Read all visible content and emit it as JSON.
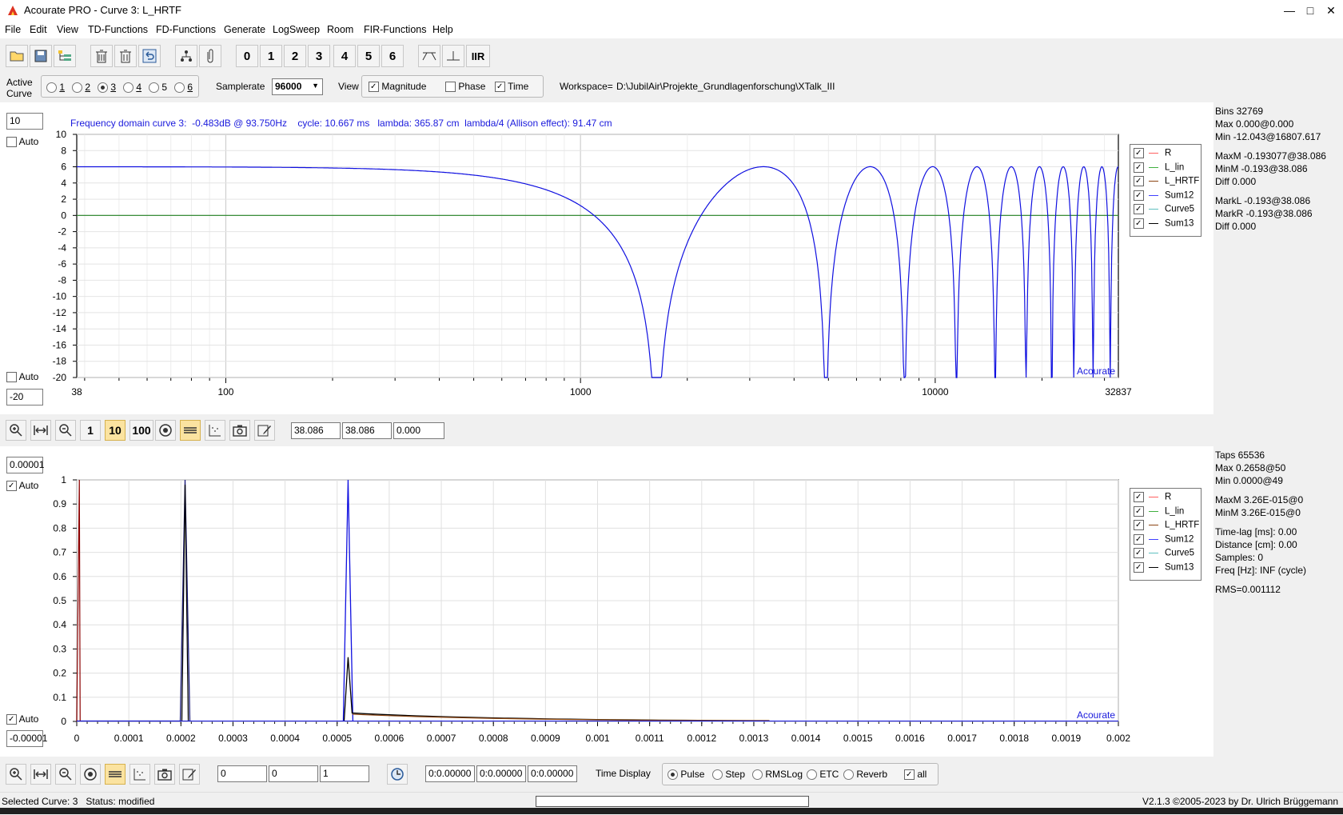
{
  "window": {
    "title": "Acourate PRO - Curve 3: L_HRTF"
  },
  "menu": [
    "File",
    "Edit",
    "View",
    "TD-Functions",
    "FD-Functions",
    "Generate",
    "LogSweep",
    "Room",
    "FIR-Functions",
    "Help"
  ],
  "toolbar": {
    "number_buttons": [
      "0",
      "1",
      "2",
      "3",
      "4",
      "5",
      "6"
    ],
    "iir_label": "IIR"
  },
  "options": {
    "active_curve_label": "Active Curve",
    "curves": [
      "1",
      "2",
      "3",
      "4",
      "5",
      "6"
    ],
    "selected_curve": "3",
    "samplerate_label": "Samplerate",
    "samplerate_value": "96000",
    "view_label": "View",
    "view_options": [
      {
        "label": "Magnitude",
        "checked": true
      },
      {
        "label": "Phase",
        "checked": false
      },
      {
        "label": "Time",
        "checked": true
      }
    ],
    "workspace_label": "Workspace=",
    "workspace_path": "D:\\JubilAir\\Projekte_Grundlagenforschung\\XTalk_III"
  },
  "freq_plot": {
    "top_input": "10",
    "bottom_input": "-20",
    "auto_label": "Auto",
    "auto_top_checked": false,
    "auto_bottom_checked": false,
    "info": "Frequency domain curve 3:  -0.483dB @ 93.750Hz    cycle: 10.667 ms   lambda: 365.87 cm  lambda/4 (Allison effect): 91.47 cm",
    "watermark": "Acourate",
    "y_ticks": [
      "10",
      "8",
      "6",
      "4",
      "2",
      "0",
      "-2",
      "-4",
      "-6",
      "-8",
      "-10",
      "-12",
      "-14",
      "-16",
      "-18",
      "-20"
    ],
    "x_ticks": [
      "38",
      "100",
      "1000",
      "10000",
      "32837"
    ],
    "legend": [
      {
        "label": "R",
        "color": "#ff6060"
      },
      {
        "label": "L_lin",
        "color": "#40b040"
      },
      {
        "label": "L_HRTF",
        "color": "#8b4513"
      },
      {
        "label": "Sum12",
        "color": "#4040ff"
      },
      {
        "label": "Curve5",
        "color": "#60c0c0"
      },
      {
        "label": "Sum13",
        "color": "#000000"
      }
    ],
    "side_info": [
      "Bins 32769",
      "Max 0.000@0.000",
      "Min -12.043@16807.617",
      "",
      "MaxM -0.193077@38.086",
      "MinM -0.193@38.086",
      "Diff 0.000",
      "",
      "MarkL -0.193@38.086",
      "MarkR -0.193@38.086",
      "Diff 0.000"
    ]
  },
  "freq_controls": {
    "buttons": [
      "1",
      "10",
      "100"
    ],
    "active_button": "10",
    "fields": [
      "38.086",
      "38.086",
      "0.000"
    ]
  },
  "time_plot": {
    "top_input": "0.00001",
    "bottom_input": "-0.00001",
    "auto_label": "Auto",
    "auto_top_checked": true,
    "auto_bottom_checked": true,
    "watermark": "Acourate",
    "y_ticks": [
      "1",
      "0.9",
      "0.8",
      "0.7",
      "0.6",
      "0.5",
      "0.4",
      "0.3",
      "0.2",
      "0.1",
      "0"
    ],
    "x_ticks": [
      "0",
      "0.0001",
      "0.0002",
      "0.0003",
      "0.0004",
      "0.0005",
      "0.0006",
      "0.0007",
      "0.0008",
      "0.0009",
      "0.001",
      "0.0011",
      "0.0012",
      "0.0013",
      "0.0014",
      "0.0015",
      "0.0016",
      "0.0017",
      "0.0018",
      "0.0019",
      "0.002"
    ],
    "legend": [
      {
        "label": "R",
        "color": "#ff6060"
      },
      {
        "label": "L_lin",
        "color": "#40b040"
      },
      {
        "label": "L_HRTF",
        "color": "#8b4513"
      },
      {
        "label": "Sum12",
        "color": "#4040ff"
      },
      {
        "label": "Curve5",
        "color": "#60c0c0"
      },
      {
        "label": "Sum13",
        "color": "#000000"
      }
    ],
    "side_info": [
      "Taps 65536",
      "Max 0.2658@50",
      "Min 0.0000@49",
      "",
      "MaxM 3.26E-015@0",
      "MinM 3.26E-015@0",
      "",
      "Time-lag [ms]: 0.00",
      "Distance [cm]: 0.00",
      "Samples:  0",
      "Freq [Hz]: INF (cycle)",
      "",
      "RMS=0.001112"
    ]
  },
  "time_controls": {
    "fields_a": [
      "0",
      "0",
      "1"
    ],
    "fields_b": [
      "0:0.00000",
      "0:0.00000",
      "0:0.00000"
    ],
    "time_display_label": "Time Display",
    "display_options": [
      "Pulse",
      "Step",
      "RMSLog",
      "ETC",
      "Reverb"
    ],
    "selected_display": "Pulse",
    "all_label": "all",
    "all_checked": true
  },
  "status": {
    "left": "Selected Curve: 3   Status: modified",
    "right": "V2.1.3 ©2005-2023 by Dr. Ulrich Brüggemann"
  }
}
